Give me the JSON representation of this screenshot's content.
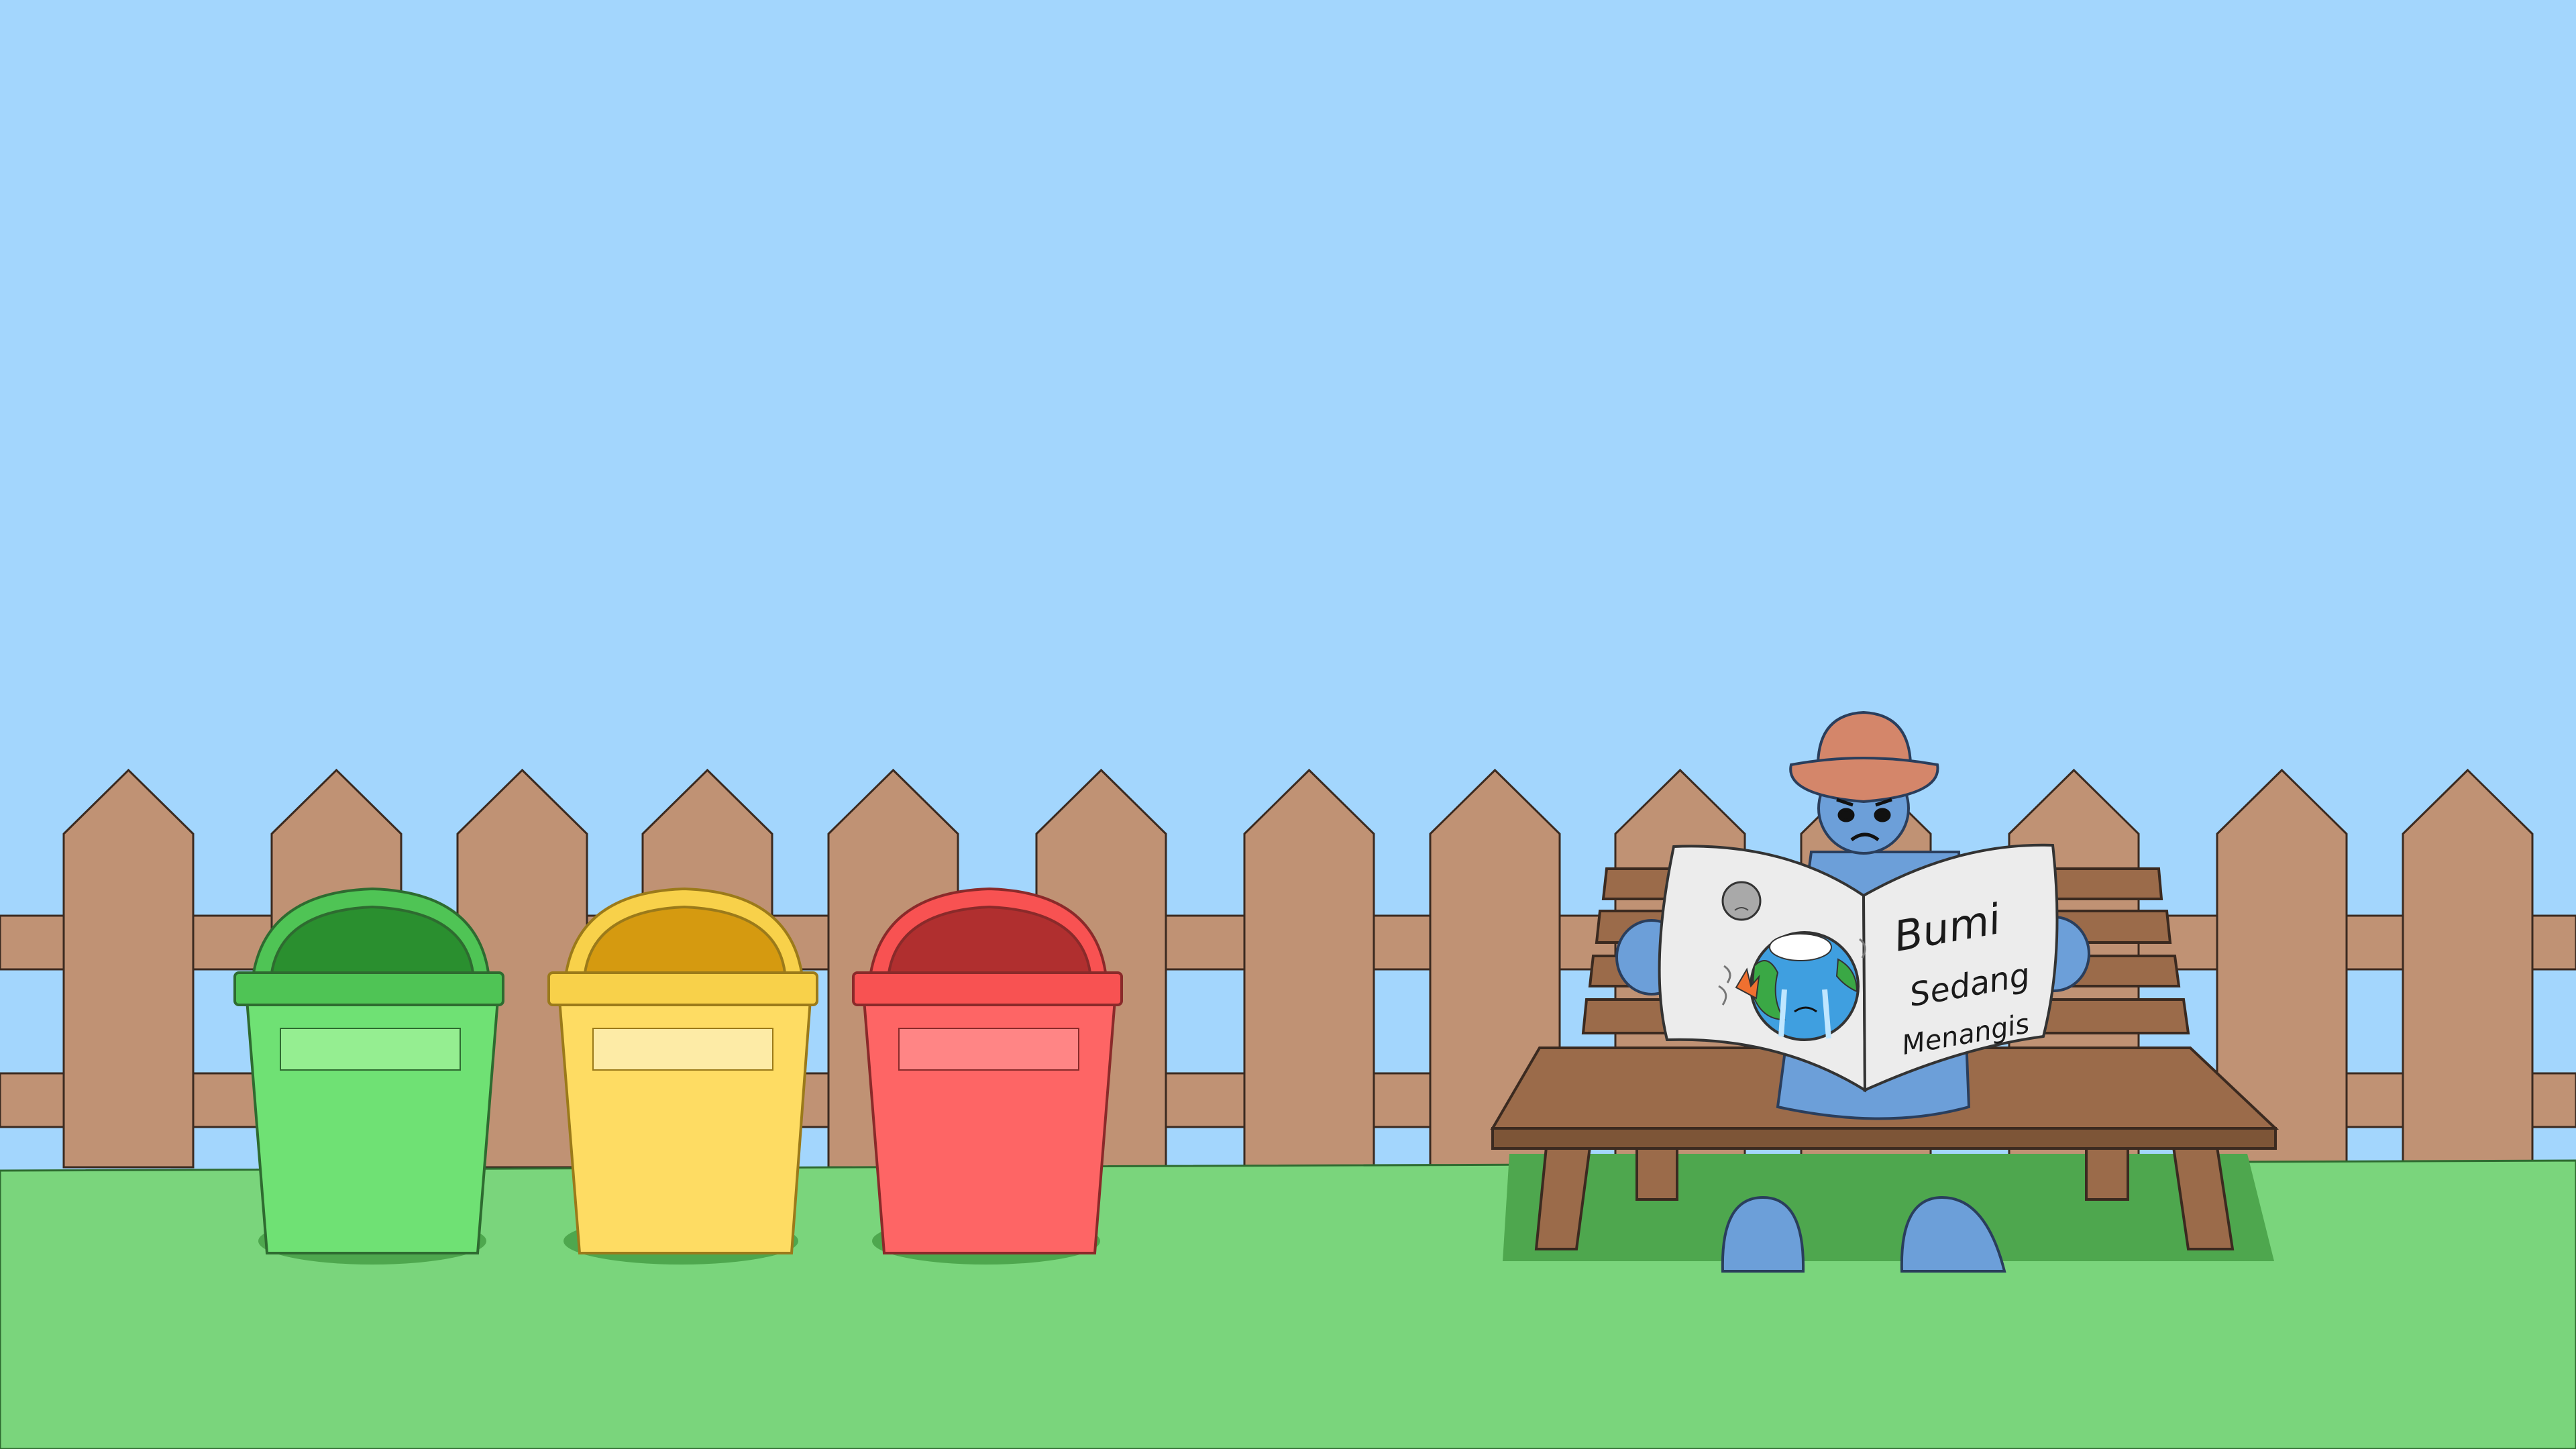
{
  "scene": {
    "sky_color": "#a3d6fd",
    "grass_color": "#7ad57c",
    "fence_color": "#c09274",
    "bench_color": "#9b6b4a",
    "hat_color": "#d4866a",
    "character_color": "#6c9fd9"
  },
  "bins": [
    {
      "name": "green-bin",
      "body_color": "#6fe174",
      "rim_color": "#4fc455",
      "opening_color": "#2a8f2f",
      "label_color": "#95ee91"
    },
    {
      "name": "yellow-bin",
      "body_color": "#fedc63",
      "rim_color": "#f8d14a",
      "opening_color": "#d59a10",
      "label_color": "#fdeba6"
    },
    {
      "name": "red-bin",
      "body_color": "#fe6565",
      "rim_color": "#f85252",
      "opening_color": "#b02f2f",
      "label_color": "#ff8585"
    }
  ],
  "newspaper": {
    "headline_1": "Bumi",
    "headline_2": "Sedang",
    "headline_3": "Menangis"
  }
}
